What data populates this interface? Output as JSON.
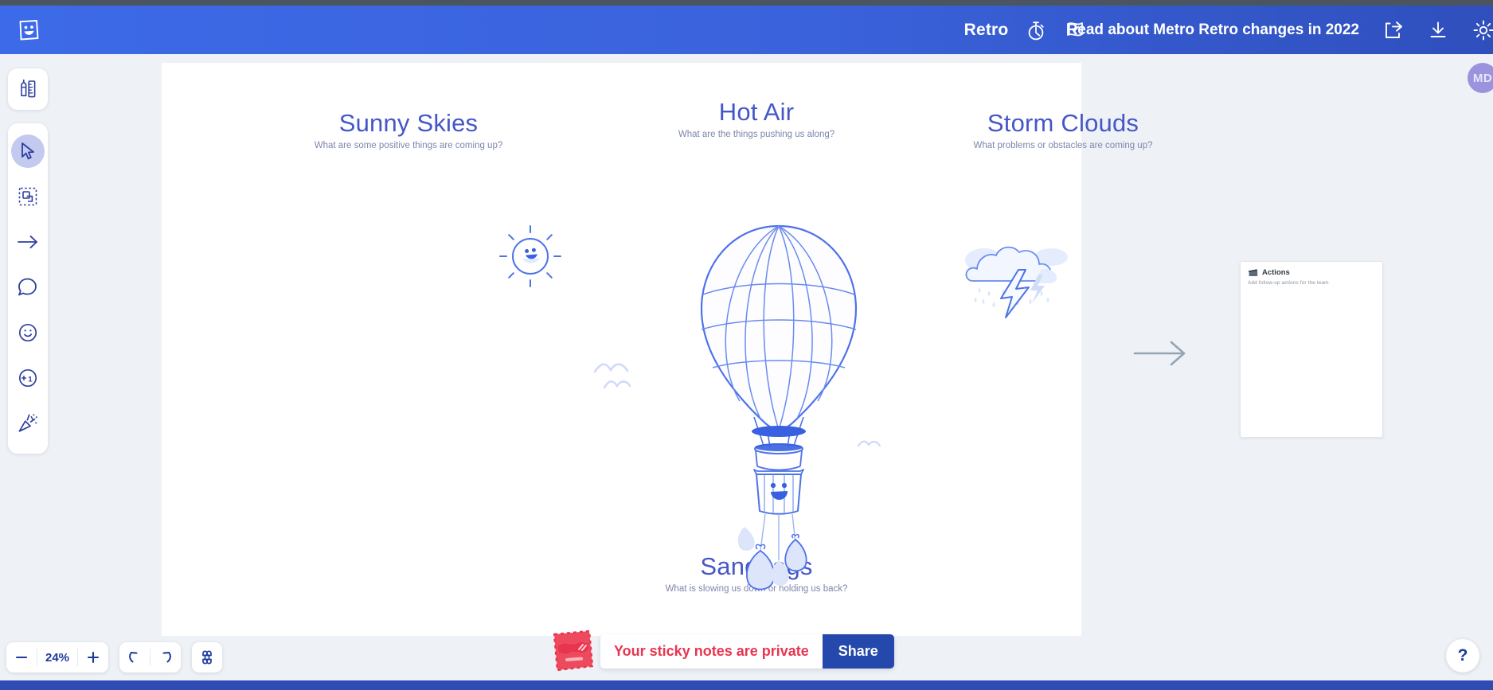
{
  "app": {
    "brand_icon": "sticky-note-face-logo",
    "accent_blue": "#3d6ae8",
    "board_blue": "#4557c8",
    "alert_red": "#e8354f"
  },
  "header": {
    "title": "Retro",
    "timer_icon": "stopwatch-icon",
    "vote_icon": "flag-check-icon",
    "promo_text": "Read about Metro Retro changes in 2022",
    "share_icon": "share-export-icon",
    "download_icon": "download-icon",
    "settings_icon": "gear-icon"
  },
  "avatar": {
    "initials": "MD"
  },
  "toolbar": {
    "items": [
      {
        "name": "pen-ruler-icon",
        "label": "Tools",
        "active": false
      },
      {
        "name": "cursor-icon",
        "label": "Select",
        "active": true
      },
      {
        "name": "marquee-select-icon",
        "label": "Frame select",
        "active": false
      },
      {
        "name": "arrow-icon",
        "label": "Arrow",
        "active": false
      },
      {
        "name": "comment-icon",
        "label": "Comment",
        "active": false
      },
      {
        "name": "emoji-icon",
        "label": "Reaction",
        "active": false
      },
      {
        "name": "plus-one-icon",
        "label": "Vote",
        "active": false
      },
      {
        "name": "confetti-icon",
        "label": "Celebrate",
        "active": false
      }
    ]
  },
  "board": {
    "columns": [
      {
        "title": "Sunny Skies",
        "prompt": "What are some positive things are coming up?"
      },
      {
        "title": "Hot Air",
        "prompt": "What are the things pushing us along?"
      },
      {
        "title": "Storm Clouds",
        "prompt": "What problems or obstacles are coming up?"
      },
      {
        "title": "Sandbags",
        "prompt": "What is slowing us down or holding us back?"
      }
    ],
    "artwork": [
      "sun-icon",
      "hot-air-balloon-illustration",
      "storm-cloud-icon",
      "birds-icon",
      "birds-icon",
      "sandbags-illustration"
    ],
    "flow_arrow_icon": "arrow-right-icon"
  },
  "actions_card": {
    "icon": "clapperboard-icon",
    "title": "Actions",
    "subtitle": "Add follow-up actions for the team"
  },
  "footer": {
    "zoom_out_icon": "minus-icon",
    "zoom_level": "24%",
    "zoom_in_icon": "plus-icon",
    "undo_icon": "undo-icon",
    "redo_icon": "redo-icon",
    "shortcuts_icon": "command-key-icon",
    "privacy_face_icon": "sticky-note-sunglasses-face",
    "privacy_message": "Your sticky notes are private",
    "share_label": "Share",
    "help_label": "?"
  }
}
